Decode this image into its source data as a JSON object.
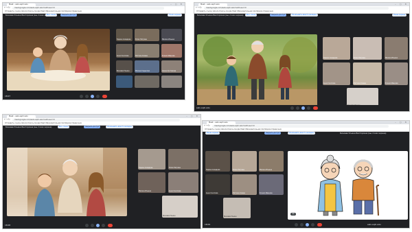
{
  "browser": {
    "tab_title": "Meet – eeb-ueph-wzu",
    "url": "meet.google.com/eeb-ueph-wzu?authuser=0",
    "window_controls": "– ▢ ✕",
    "bookmarks": "Отправить ссылку  Школа  Классы Google Meet  Образовательная платформа  Справочник"
  },
  "meeting": {
    "title": "Бичиева Ульяна Викторовна (вы, показ экрана)",
    "show_tab_button": "Вкл. показ",
    "stop_button": "Закрыть доступ",
    "share_button": "Показывать вместо вкладки",
    "display_button": "Показ экрана",
    "code": "eeb-ueph-wzu",
    "time1": "18:07",
    "time2": "18:08",
    "time3": "18:09"
  },
  "participants": {
    "p1": "Зарина Ахмедова",
    "p2": "Юлия Петрова",
    "p3": "Малика Ильина",
    "p4": "Анна Соколова",
    "p5": "Фатима Алиева",
    "p6": "Ксения Иванова",
    "p7": "Бичиева Ульяна",
    "p8": "Милана Садыкова",
    "p9": "Амина Рустамова"
  },
  "colors": {
    "accent": "#8ab4f8",
    "end_call": "#ea4335",
    "meet_bg": "#202124"
  }
}
